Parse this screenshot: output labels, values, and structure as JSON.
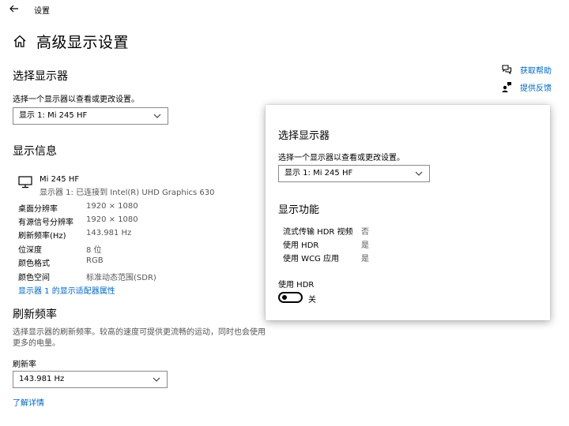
{
  "app": {
    "title": "设置"
  },
  "page": {
    "title": "高级显示设置"
  },
  "select_display": {
    "heading": "选择显示器",
    "description": "选择一个显示器以查看或更改设置。",
    "selected": "显示 1: Mi 245 HF"
  },
  "display_info": {
    "heading": "显示信息",
    "monitor_name": "Mi 245 HF",
    "monitor_subtitle": "显示器 1: 已连接到 Intel(R) UHD Graphics 630",
    "rows": [
      {
        "label": "桌面分辨率",
        "value": "1920 × 1080"
      },
      {
        "label": "有源信号分辨率",
        "value": "1920 × 1080"
      },
      {
        "label": "刷新频率(Hz)",
        "value": "143.981 Hz"
      },
      {
        "label": "位深度",
        "value": "8 位"
      },
      {
        "label": "颜色格式",
        "value": "RGB"
      },
      {
        "label": "颜色空间",
        "value": "标准动态范围(SDR)"
      }
    ],
    "adapter_link": "显示器 1 的显示适配器属性"
  },
  "refresh": {
    "heading": "刷新频率",
    "description_line1": "选择显示器的刷新频率。较高的速度可提供更流畅的运动，同时也会使用",
    "description_line2": "更多的电量。",
    "field_label": "刷新率",
    "selected": "143.981 Hz",
    "learn_more": "了解详情"
  },
  "help": {
    "get_help": "获取帮助",
    "feedback": "提供反馈"
  },
  "overlay": {
    "select_heading": "选择显示器",
    "select_description": "选择一个显示器以查看或更改设置。",
    "selected": "显示 1: Mi 245 HF",
    "features_heading": "显示功能",
    "features": [
      {
        "label": "流式传输 HDR 视频",
        "value": "否"
      },
      {
        "label": "使用 HDR",
        "value": "是"
      },
      {
        "label": "使用 WCG 应用",
        "value": "是"
      }
    ],
    "hdr_toggle_label": "使用 HDR",
    "hdr_toggle_state": "关"
  },
  "colors": {
    "accent": "#0067c0"
  }
}
